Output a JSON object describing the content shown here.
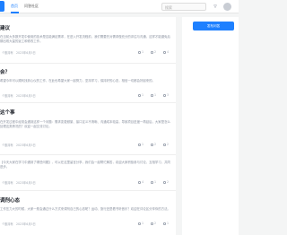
{
  "nav": {
    "tabs": [
      "首页",
      "问答社区"
    ],
    "search_placeholder": "搜索",
    "bell_icon": "bell-icon"
  },
  "sidebar": {
    "button_label": "发布问答"
  },
  "items": [
    {
      "title": "建议",
      "desc": "在当前大多数开发中使用的技术是否能满足需求，在进入开发流程前，我们需要先对需求做充分的评估与沟通，这样才能避免后期出现大量的返工和修改工作。",
      "meta": [
        "个股持有",
        "2023年6月5日",
        "1",
        "2",
        "4"
      ]
    },
    {
      "title": "会？",
      "desc": "希望今年可以顺利找到心仪的工作，在此也希望大家一起努力，坚持学习，保持好的心态，相信一切都会好起来的。",
      "meta": [
        "个股持有",
        "2023年6月5日",
        "1",
        "1",
        "3"
      ]
    },
    {
      "title": "这个事",
      "desc": "在开发过程中经常会遇到这样一个问题：需求变更频繁、接口定义不清晰、沟通成本较高，导致项目进度一再延后，大家是怎么处理这类情况的？欢迎一起交流讨论。",
      "meta": [
        "个股持有",
        "2023年6月5日",
        "1",
        "2",
        "2"
      ]
    },
    {
      "title": "",
      "desc": "【今天大家在学习中遇到了哪些问题】，可以在这里留言分享，我们会一起帮忙解答，欢迎大家积极参与讨论，互相学习，共同进步。",
      "meta": [
        "个股持有",
        "2023年6月5日",
        "4",
        "1",
        "2"
      ]
    },
    {
      "title": "调剂心态",
      "desc": "工作压力大的时候，大家一般会通过什么方式来调剂自己的心态呢？运动、旅行还是看书听音乐？欢迎在评论区分享你的方法。",
      "meta": [
        "个股持有",
        "2023年6月5日",
        "1",
        "2",
        "1"
      ]
    }
  ]
}
